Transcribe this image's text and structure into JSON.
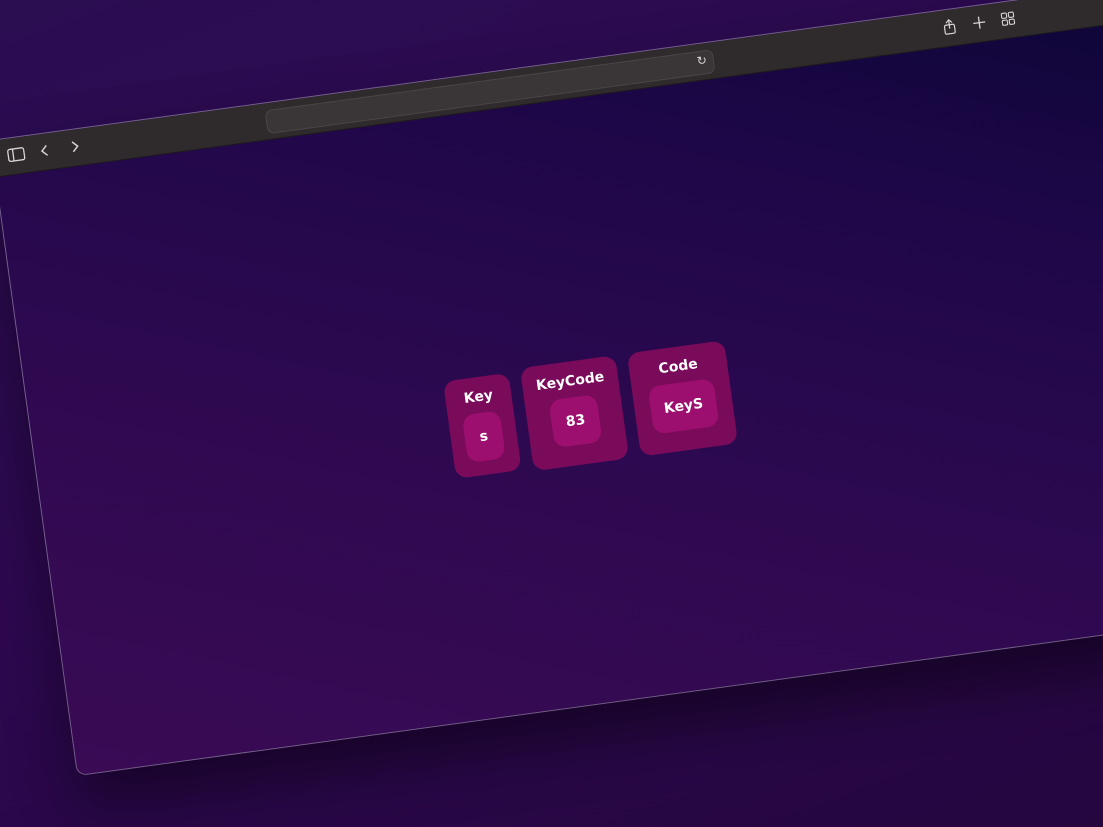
{
  "browser": {
    "toolbar": {
      "sidebar_icon": "sidebar-icon",
      "back_icon": "back-icon",
      "forward_icon": "forward-icon",
      "reload_icon": "reload-icon",
      "share_icon": "share-icon",
      "new_tab_icon": "plus-icon",
      "tabs_overview_icon": "tab-overview-icon"
    },
    "address": {
      "value": ""
    }
  },
  "key_info": {
    "key": {
      "label": "Key",
      "value": "s"
    },
    "keycode": {
      "label": "KeyCode",
      "value": "83"
    },
    "code": {
      "label": "Code",
      "value": "KeyS"
    }
  },
  "colors": {
    "card_background": "#7a0a5a",
    "card_value_background": "#9c0f6e",
    "page_background": "#2c0950",
    "toolbar_background": "#2f2a2c"
  }
}
